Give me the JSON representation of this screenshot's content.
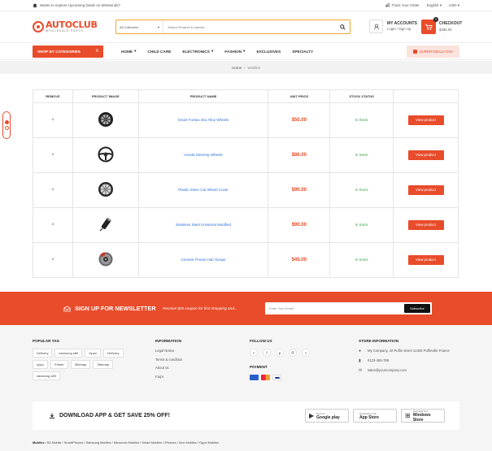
{
  "topbar": {
    "promo": "Wants to explore Upcoming Deals on Weekends?",
    "track": "Track Your Order",
    "language": "English",
    "currency": "USD"
  },
  "logo": {
    "main": "AUTOCLUB",
    "sub": "WHOLESALE PARTS"
  },
  "search": {
    "category": "All Collection",
    "placeholder": "Search Product & brands..."
  },
  "account": {
    "title": "MY ACCOUNTS",
    "sub": "Login / Sign Up"
  },
  "checkout": {
    "title": "CHECKOUT",
    "amount": "$385.00",
    "count": "0"
  },
  "nav": {
    "shop_categories": "SHOP BY CATEGORIES",
    "items": [
      "HOME",
      "CHILD CARE",
      "ELECTRONICS",
      "FASHION",
      "EXCLUSIVES",
      "SPECIALTY"
    ],
    "super_deals": "SUPER DEALS DAY"
  },
  "breadcrumb": {
    "home": "Home",
    "sep": "/",
    "current": "Wishlist"
  },
  "wishlist": {
    "headers": [
      "REMOVE",
      "PRODUCT IMAGE",
      "PRODUCT NAME",
      "UNIT PRICE",
      "STOCK STATUS",
      ""
    ],
    "remove_symbol": "×",
    "button_label": "View product",
    "rows": [
      {
        "name": "Smart Fortwo 451 Alloy Wheels",
        "price": "$50.00",
        "stock": "In Stock",
        "icon": "alloy-wheel"
      },
      {
        "name": "Honda Steering Wheels",
        "price": "$86.00",
        "stock": "In Stock",
        "icon": "steering-wheel"
      },
      {
        "name": "Plastic Silver Car Wheel Cover",
        "price": "$90.00",
        "stock": "In Stock",
        "icon": "wheel-cover"
      },
      {
        "name": "Stainless Steel Universal Modified",
        "price": "$90.00",
        "stock": "In Stock",
        "icon": "exhaust-pipe"
      },
      {
        "name": "Cometic Preset Hub Torque",
        "price": "$45.00",
        "stock": "In Stock",
        "icon": "brake-disc"
      }
    ]
  },
  "newsletter": {
    "title": "SIGN UP FOR NEWSLETTER",
    "desc": "Receive $20 coupon for first shopping and...",
    "placeholder": "Enter Your Email",
    "button": "Subscribe"
  },
  "footer": {
    "popular_tag": {
      "title": "POPULAR TAG",
      "tags": [
        "Delivery",
        "samsung s80",
        "Oppo",
        "Delivery",
        "oppo",
        "Printer",
        "Sitemap",
        "Sitemap",
        "samsung a50"
      ]
    },
    "information": {
      "title": "INFORMATION",
      "links": [
        "Legal Notice",
        "Terms & condition",
        "About us",
        "Faq's"
      ]
    },
    "follow": {
      "title": "FOLLOW US",
      "icons": [
        "twitter",
        "facebook",
        "pinterest",
        "instagram",
        "tumblr"
      ],
      "glyphs": [
        "t",
        "f",
        "p",
        "◎",
        "t"
      ]
    },
    "payment": {
      "title": "PAYMENT",
      "colors": [
        "#2a5fc9",
        "#f0a030",
        "#1a3c8f"
      ]
    },
    "store": {
      "title": "STORE INFORMATION",
      "address": "My Company, 42 Puffin street 12345 Puffinville France",
      "phone": "0123-456-789",
      "email": "sales@yourcompany.com"
    }
  },
  "app": {
    "title": "DOWNLOAD APP & GET SAVE 25% OFF!",
    "stores": [
      {
        "small": "Get it on",
        "big": "Google play",
        "icon": "▶"
      },
      {
        "small": "Download on the",
        "big": "App Store",
        "icon": ""
      },
      {
        "small": "Download from",
        "big": "Windows Store",
        "icon": "⊞"
      }
    ]
  },
  "bottom_links": {
    "label": "Mobiles",
    "items": [
      "5G Mobile",
      "SmartPhones",
      "Samsung Mobiles",
      "Micromax Mobiles",
      "Smart Mobiles",
      "iPhones",
      "Vivo Mobiles",
      "Oppo Mobiles"
    ]
  },
  "colors": {
    "accent": "#e84c2b",
    "link": "#2f6fd6",
    "instock": "#3aa24a"
  }
}
